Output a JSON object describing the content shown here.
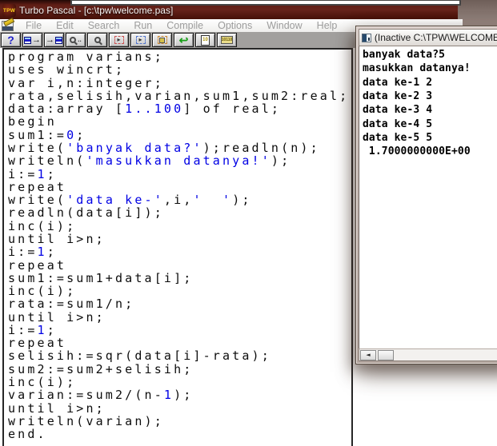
{
  "window": {
    "title": "Turbo Pascal - [c:\\tpw\\welcome.pas]",
    "app_icon_text": "TPW"
  },
  "menu": {
    "items": [
      "File",
      "Edit",
      "Search",
      "Run",
      "Compile",
      "Options",
      "Window",
      "Help"
    ]
  },
  "toolbar": {
    "buttons": [
      "help-button",
      "open-file-button",
      "save-file-button",
      "find-button",
      "search-again-button",
      "cut-button",
      "copy-button",
      "paste-button",
      "undo-button",
      "compile-button",
      "make-button"
    ]
  },
  "editor": {
    "code": [
      [
        [
          "program varians;",
          "k"
        ]
      ],
      [
        [
          "uses wincrt;",
          "k"
        ]
      ],
      [
        [
          "var i,n:integer;",
          "k"
        ]
      ],
      [
        [
          "rata,selisih,varian,sum1,sum2:real;",
          "k"
        ]
      ],
      [
        [
          "data:array [",
          "k"
        ],
        [
          "1..100",
          "b"
        ],
        [
          "] of real;",
          "k"
        ]
      ],
      [
        [
          "begin",
          "k"
        ]
      ],
      [
        [
          "sum1:=",
          "k"
        ],
        [
          "0",
          "b"
        ],
        [
          ";",
          "k"
        ]
      ],
      [
        [
          "write(",
          "k"
        ],
        [
          "'banyak data?'",
          "b"
        ],
        [
          ");readln(n);",
          "k"
        ]
      ],
      [
        [
          "writeln(",
          "k"
        ],
        [
          "'masukkan datanya!'",
          "b"
        ],
        [
          ");",
          "k"
        ]
      ],
      [
        [
          "i:=",
          "k"
        ],
        [
          "1",
          "b"
        ],
        [
          ";",
          "k"
        ]
      ],
      [
        [
          "repeat",
          "k"
        ]
      ],
      [
        [
          "write(",
          "k"
        ],
        [
          "'data ke-'",
          "b"
        ],
        [
          ",i,",
          "k"
        ],
        [
          "'  '",
          "b"
        ],
        [
          ");",
          "k"
        ]
      ],
      [
        [
          "readln(data[i]);",
          "k"
        ]
      ],
      [
        [
          "inc(i);",
          "k"
        ]
      ],
      [
        [
          "until i>n;",
          "k"
        ]
      ],
      [
        [
          "i:=",
          "k"
        ],
        [
          "1",
          "b"
        ],
        [
          ";",
          "k"
        ]
      ],
      [
        [
          "repeat",
          "k"
        ]
      ],
      [
        [
          "sum1:=sum1+data[i];",
          "k"
        ]
      ],
      [
        [
          "inc(i);",
          "k"
        ]
      ],
      [
        [
          "rata:=sum1/n;",
          "k"
        ]
      ],
      [
        [
          "until i>n;",
          "k"
        ]
      ],
      [
        [
          "i:=",
          "k"
        ],
        [
          "1",
          "b"
        ],
        [
          ";",
          "k"
        ]
      ],
      [
        [
          "repeat",
          "k"
        ]
      ],
      [
        [
          "selisih:=sqr(data[i]-rata);",
          "k"
        ]
      ],
      [
        [
          "sum2:=sum2+selisih;",
          "k"
        ]
      ],
      [
        [
          "inc(i);",
          "k"
        ]
      ],
      [
        [
          "varian:=sum2/(n-",
          "k"
        ],
        [
          "1",
          "b"
        ],
        [
          ");",
          "k"
        ]
      ],
      [
        [
          "until i>n;",
          "k"
        ]
      ],
      [
        [
          "writeln(varian);",
          "k"
        ]
      ],
      [
        [
          "end.",
          "k"
        ]
      ]
    ]
  },
  "console": {
    "title": "(Inactive C:\\TPW\\WELCOME.PAS)",
    "lines": [
      "banyak data?5",
      "masukkan datanya!",
      "data ke-1 2",
      "data ke-2 3",
      "data ke-3 4",
      "data ke-4 5",
      "data ke-5 5",
      " 1.7000000000E+00"
    ]
  },
  "icons": {
    "scroll_left": "◄"
  },
  "colors": {
    "syntax_literal_blue": "#0000e4",
    "titlebar_maroon": "#53160f",
    "desktop_brown": "#8e7d77"
  }
}
